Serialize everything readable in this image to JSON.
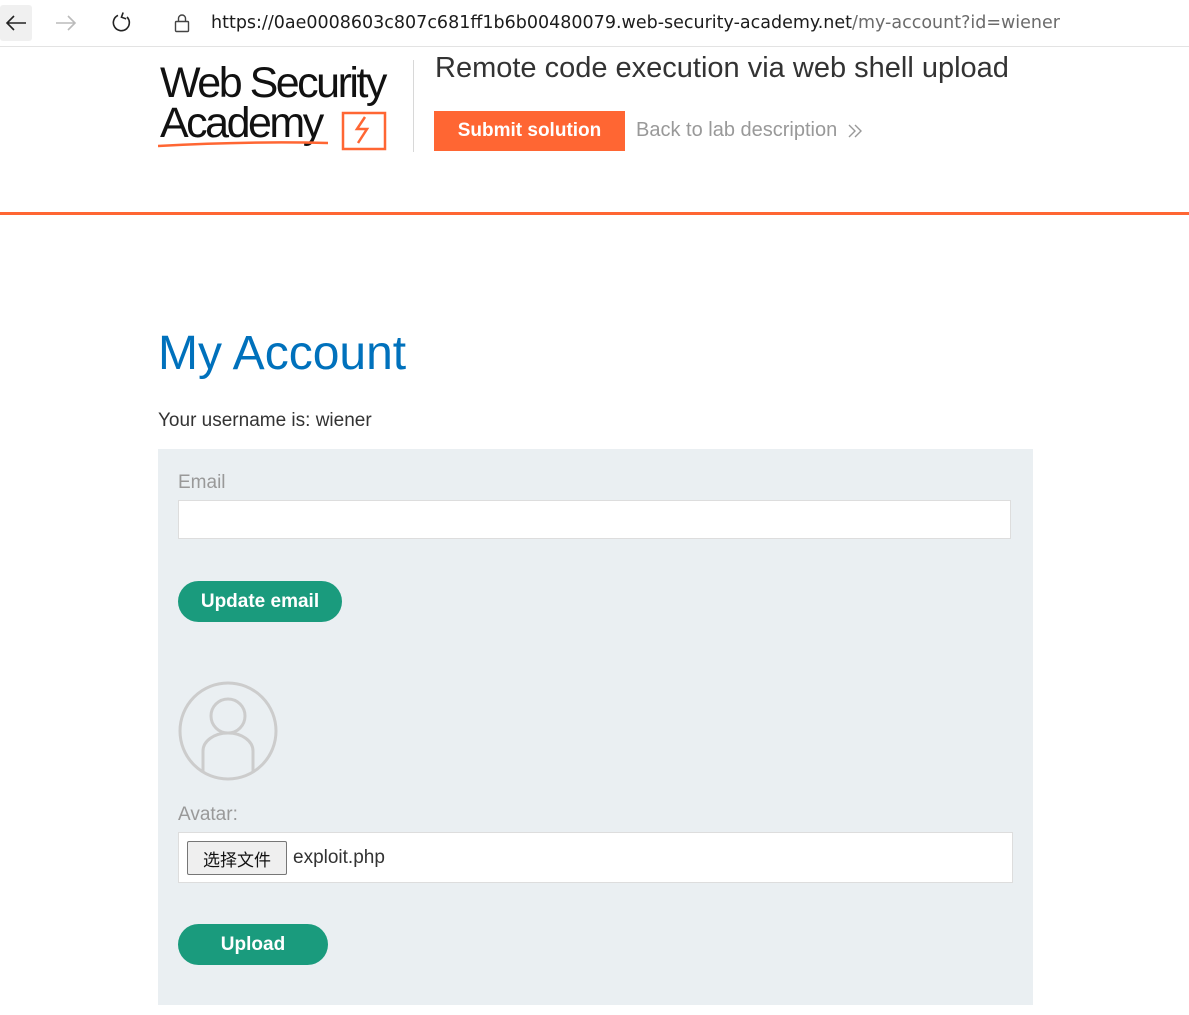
{
  "browser": {
    "url_host": "https://0ae0008603c807c681ff1b6b00480079.web-security-academy.net",
    "url_path": "/my-account?id=wiener"
  },
  "header": {
    "logo_line1": "Web Security",
    "logo_line2": "Academy",
    "lab_title": "Remote code execution via web shell upload",
    "submit_label": "Submit solution",
    "back_label": "Back to lab description"
  },
  "account": {
    "title": "My Account",
    "username_text": "Your username is: wiener",
    "email_label": "Email",
    "email_value": "",
    "update_email_label": "Update email",
    "avatar_label": "Avatar:",
    "choose_file_label": "选择文件",
    "file_name": "exploit.php",
    "upload_label": "Upload"
  },
  "colors": {
    "accent": "#ff6633",
    "title_blue": "#0071bc",
    "button_green": "#1a9b7d",
    "panel_bg": "#eaeff2"
  },
  "icons": [
    "back-arrow-icon",
    "forward-arrow-icon",
    "reload-icon",
    "lock-icon",
    "chevron-right-icon",
    "avatar-icon"
  ]
}
